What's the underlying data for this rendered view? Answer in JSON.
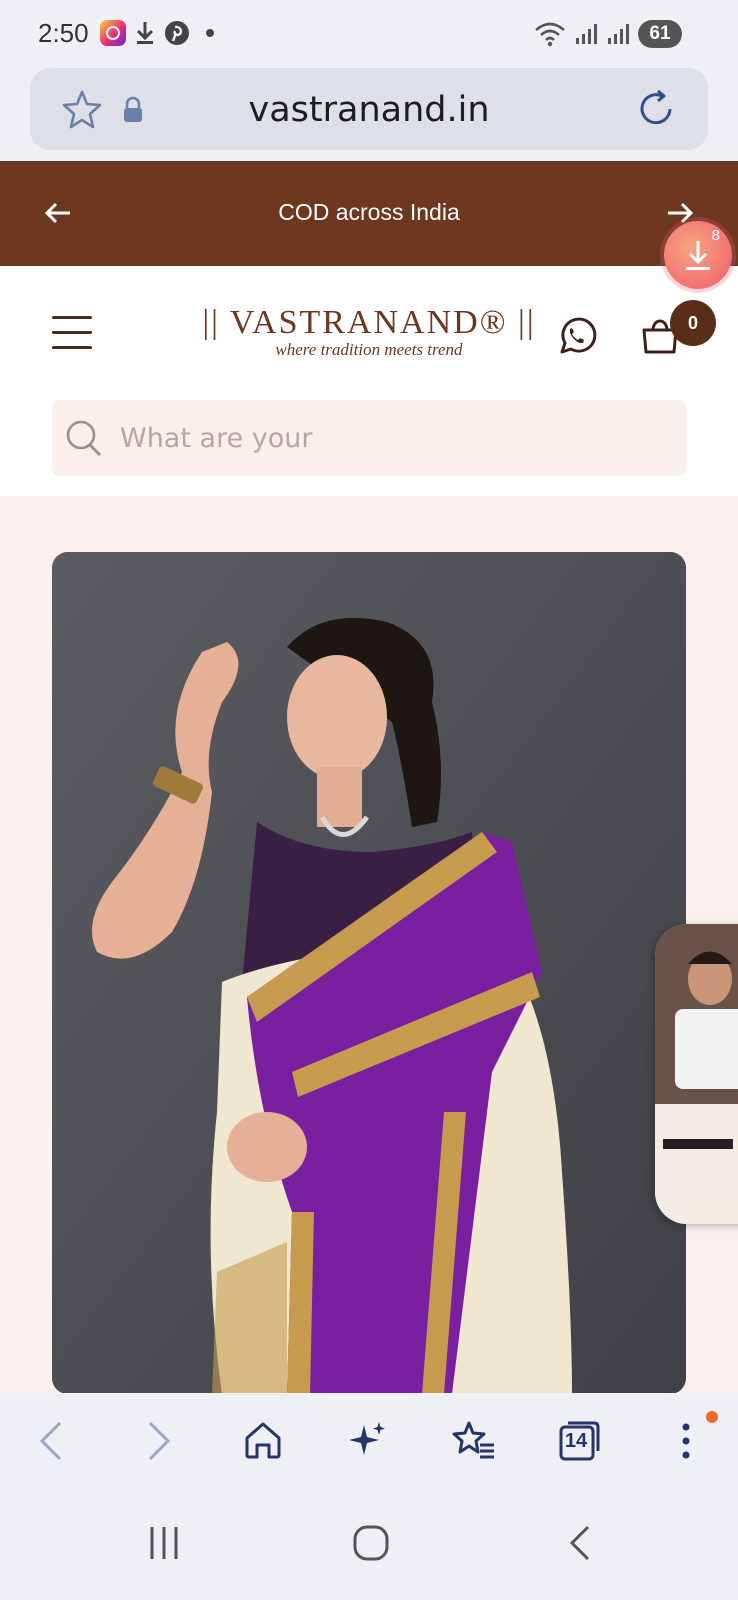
{
  "status_bar": {
    "time": "2:50",
    "battery": "61"
  },
  "browser": {
    "url": "vastranand.in",
    "tab_count": "14"
  },
  "announcement": {
    "text": "COD across India"
  },
  "download_badge": {
    "count": "8"
  },
  "header": {
    "logo_text": "|| VASTRANAND® ||",
    "logo_tagline": "where tradition meets trend",
    "cart_count": "0"
  },
  "search": {
    "placeholder": "What are your"
  },
  "colors": {
    "brand_brown": "#6e3720",
    "page_bg": "#fbf0ee",
    "saree_purple": "#7a1fa0",
    "accent_orange": "#f26a2b"
  },
  "icons": {
    "toolbar": [
      "back-icon",
      "forward-icon",
      "home-icon",
      "sparkle-icon",
      "bookmarks-icon",
      "tabs-icon",
      "more-icon"
    ],
    "system_nav": [
      "recent-apps-icon",
      "home-circle-icon",
      "back-chevron-icon"
    ]
  }
}
